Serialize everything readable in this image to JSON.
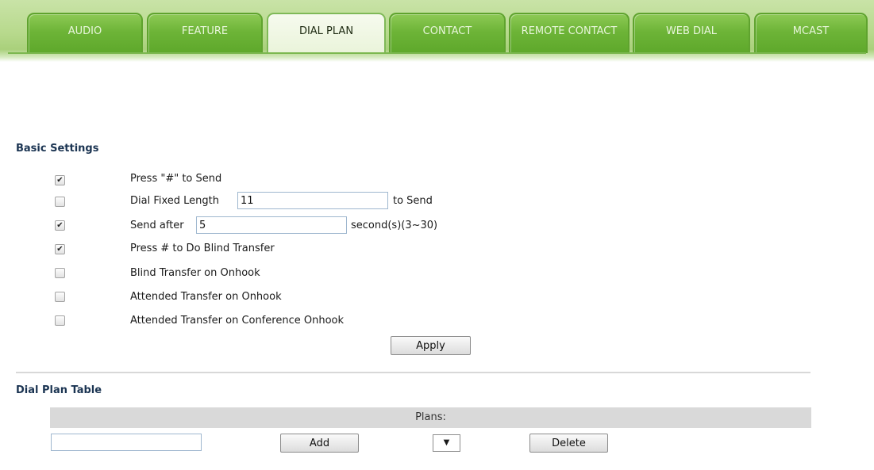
{
  "tabs": [
    {
      "label": "AUDIO",
      "active": false
    },
    {
      "label": "FEATURE",
      "active": false
    },
    {
      "label": "DIAL PLAN",
      "active": true
    },
    {
      "label": "CONTACT",
      "active": false
    },
    {
      "label": "REMOTE CONTACT",
      "active": false
    },
    {
      "label": "WEB DIAL",
      "active": false
    },
    {
      "label": "MCAST",
      "active": false
    }
  ],
  "basic_settings": {
    "title": "Basic Settings",
    "press_hash_send": {
      "checked": true,
      "label": "Press \"#\" to Send"
    },
    "dial_fixed_length": {
      "checked": false,
      "label": "Dial Fixed Length",
      "value": "11",
      "suffix": "to Send"
    },
    "send_after": {
      "checked": true,
      "label": "Send after",
      "value": "5",
      "suffix": "second(s)(3~30)"
    },
    "press_hash_blind_transfer": {
      "checked": true,
      "label": "Press # to Do Blind Transfer"
    },
    "blind_transfer_onhook": {
      "checked": false,
      "label": "Blind Transfer on Onhook"
    },
    "attended_transfer_onhook": {
      "checked": false,
      "label": "Attended Transfer on Onhook"
    },
    "attended_transfer_conference_onhook": {
      "checked": false,
      "label": "Attended Transfer on Conference Onhook"
    },
    "apply_label": "Apply"
  },
  "dial_plan_table": {
    "title": "Dial Plan Table",
    "plans_header": "Plans:",
    "new_plan_value": "",
    "add_label": "Add",
    "select_arrow": "▼",
    "delete_label": "Delete"
  },
  "colors": {
    "tab_green": "#6db437",
    "tab_active": "#eaf4da",
    "section_title": "#1b3452",
    "plans_header_bg": "#d9d9d9"
  }
}
